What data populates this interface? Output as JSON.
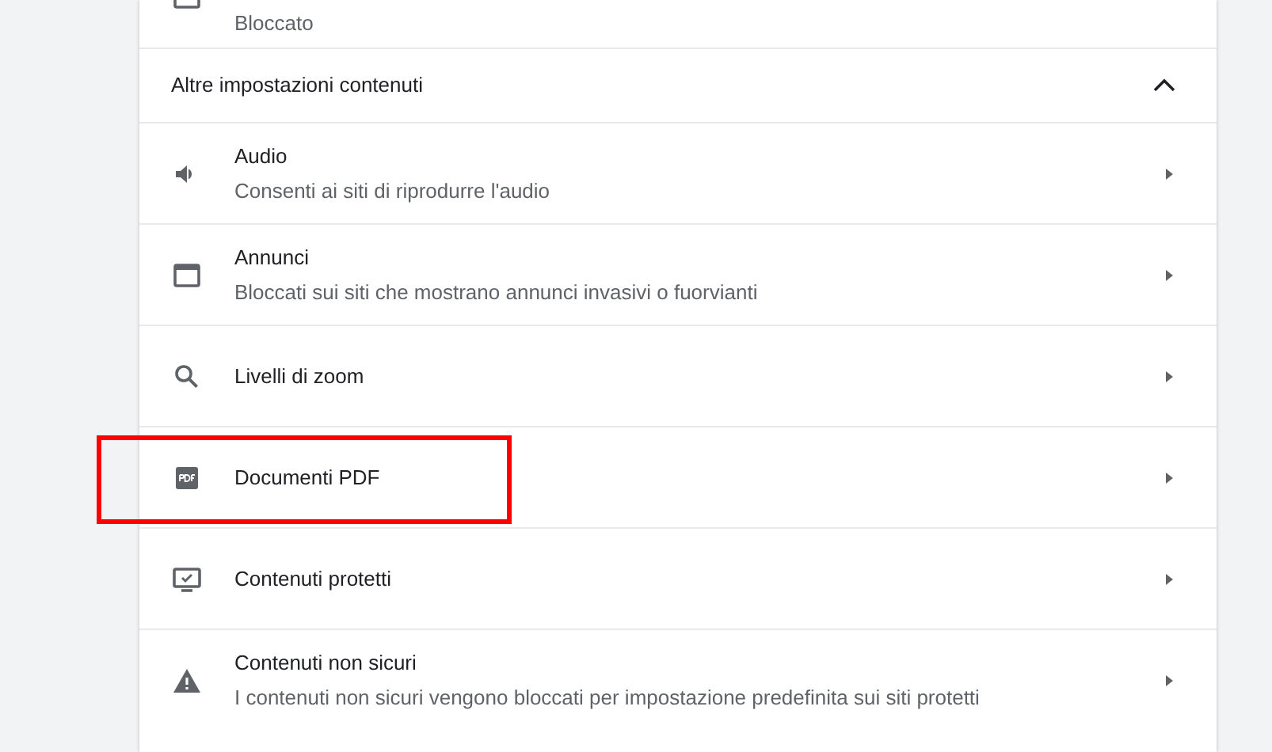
{
  "previous_item": {
    "subtitle": "Bloccato"
  },
  "section": {
    "title": "Altre impostazioni contenuti",
    "expanded": true
  },
  "items": [
    {
      "title": "Audio",
      "subtitle": "Consenti ai siti di riprodurre l'audio",
      "highlighted": false
    },
    {
      "title": "Annunci",
      "subtitle": "Bloccati sui siti che mostrano annunci invasivi o fuorvianti",
      "highlighted": false
    },
    {
      "title": "Livelli di zoom",
      "highlighted": false
    },
    {
      "title": "Documenti PDF",
      "highlighted": true
    },
    {
      "title": "Contenuti protetti",
      "highlighted": false
    },
    {
      "title": "Contenuti non sicuri",
      "subtitle": "I contenuti non sicuri vengono bloccati per impostazione predefinita sui siti protetti",
      "highlighted": false
    }
  ]
}
